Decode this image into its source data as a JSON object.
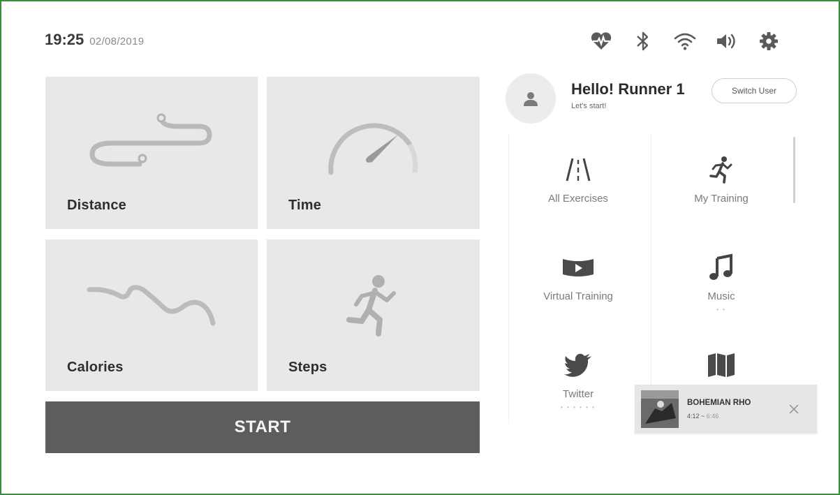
{
  "status": {
    "time": "19:25",
    "date": "02/08/2019",
    "icons": [
      "heart-rate-icon",
      "bluetooth-icon",
      "wifi-icon",
      "volume-icon",
      "gear-icon"
    ]
  },
  "tiles": {
    "distance": "Distance",
    "time": "Time",
    "calories": "Calories",
    "steps": "Steps"
  },
  "start_label": "START",
  "user": {
    "greeting": "Hello! Runner 1",
    "subtitle": "Let's start!",
    "switch_label": "Switch User"
  },
  "menu": {
    "items": [
      {
        "label": "All Exercises",
        "icon": "road-icon"
      },
      {
        "label": "My Training",
        "icon": "runner-icon"
      },
      {
        "label": "Virtual Training",
        "icon": "virtual-video-icon"
      },
      {
        "label": "Music",
        "icon": "music-note-icon"
      },
      {
        "label": "Twitter",
        "icon": "twitter-bird-icon"
      },
      {
        "label": "",
        "icon": "map-icon"
      }
    ],
    "music_dots": "• •",
    "twitter_dots": "• • • • • •"
  },
  "now_playing": {
    "title": "BOHEMIAN RHO",
    "position": "4:12",
    "separator": " ~ ",
    "duration": "6:46"
  },
  "colors": {
    "frame": "#3a8f3a",
    "tile_bg": "#e8e8e8",
    "start_bg": "#5d5d5d"
  }
}
